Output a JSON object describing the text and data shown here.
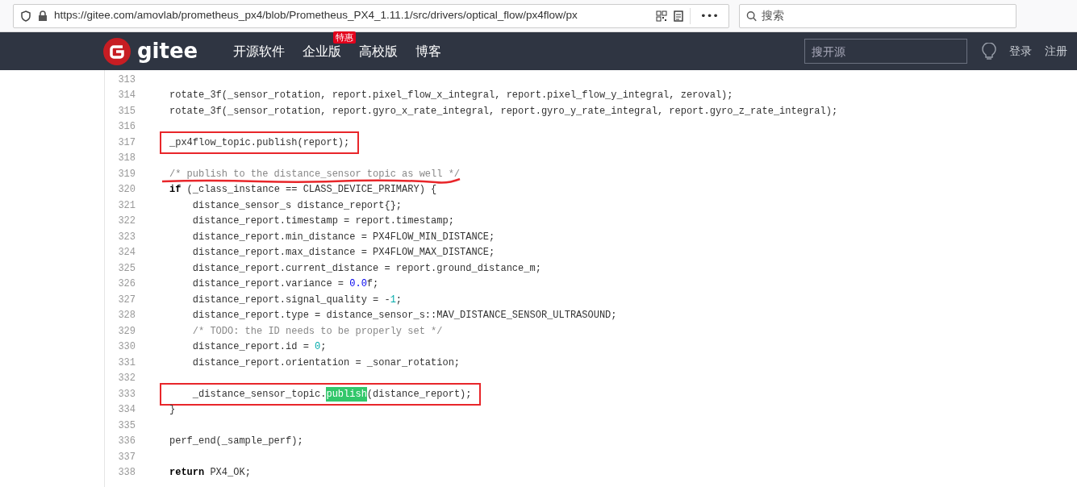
{
  "browser": {
    "url": "https://gitee.com/amovlab/prometheus_px4/blob/Prometheus_PX4_1.11.1/src/drivers/optical_flow/px4flow/px",
    "more": "•••",
    "search": {
      "placeholder": "搜索"
    }
  },
  "nav": {
    "logo": "gitee",
    "items": [
      {
        "label": "开源软件"
      },
      {
        "label": "企业版",
        "badge": "特惠"
      },
      {
        "label": "高校版"
      },
      {
        "label": "博客"
      }
    ],
    "search": {
      "placeholder": "搜开源"
    },
    "login": "登录",
    "register": "注册"
  },
  "code": [
    {
      "number": "313",
      "boxed": false,
      "underlined": false
    },
    {
      "number": "314",
      "boxed": false,
      "underlined": false,
      "tokens": [
        {
          "kind": "plain",
          "text": "rotate_3f(_sensor_rotation, report.pixel_flow_x_integral, report.pixel_flow_y_integral, zeroval);"
        }
      ]
    },
    {
      "number": "315",
      "boxed": false,
      "underlined": false,
      "tokens": [
        {
          "kind": "plain",
          "text": "rotate_3f(_sensor_rotation, report.gyro_x_rate_integral, report.gyro_y_rate_integral, report.gyro_z_rate_integral);"
        }
      ]
    },
    {
      "number": "316",
      "boxed": false,
      "underlined": false
    },
    {
      "number": "317",
      "boxed": true,
      "underlined": false,
      "tokens": [
        {
          "kind": "plain",
          "text": "_px4flow_topic.publish(report);"
        }
      ]
    },
    {
      "number": "318",
      "boxed": false,
      "underlined": false
    },
    {
      "number": "319",
      "boxed": false,
      "underlined": true,
      "tokens": [
        {
          "kind": "comment",
          "text": "/* publish to the distance_sensor topic as well */"
        }
      ]
    },
    {
      "number": "320",
      "boxed": false,
      "underlined": false,
      "tokens": [
        {
          "kind": "keyword",
          "text": "if"
        },
        {
          "kind": "plain",
          "text": " (_class_instance == CLASS_DEVICE_PRIMARY) {"
        }
      ]
    },
    {
      "number": "321",
      "boxed": false,
      "underlined": false,
      "tokens": [
        {
          "kind": "plain",
          "text": "    distance_sensor_s distance_report{};"
        }
      ]
    },
    {
      "number": "322",
      "boxed": false,
      "underlined": false,
      "tokens": [
        {
          "kind": "plain",
          "text": "    distance_report.timestamp = report.timestamp;"
        }
      ]
    },
    {
      "number": "323",
      "boxed": false,
      "underlined": false,
      "tokens": [
        {
          "kind": "plain",
          "text": "    distance_report.min_distance = PX4FLOW_MIN_DISTANCE;"
        }
      ]
    },
    {
      "number": "324",
      "boxed": false,
      "underlined": false,
      "tokens": [
        {
          "kind": "plain",
          "text": "    distance_report.max_distance = PX4FLOW_MAX_DISTANCE;"
        }
      ]
    },
    {
      "number": "325",
      "boxed": false,
      "underlined": false,
      "tokens": [
        {
          "kind": "plain",
          "text": "    distance_report.current_distance = report.ground_distance_m;"
        }
      ]
    },
    {
      "number": "326",
      "boxed": false,
      "underlined": false,
      "tokens": [
        {
          "kind": "plain",
          "text": "    distance_report.variance = "
        },
        {
          "kind": "float",
          "text": "0.0"
        },
        {
          "kind": "plain",
          "text": "f;"
        }
      ]
    },
    {
      "number": "327",
      "boxed": false,
      "underlined": false,
      "tokens": [
        {
          "kind": "plain",
          "text": "    distance_report.signal_quality = -"
        },
        {
          "kind": "int",
          "text": "1"
        },
        {
          "kind": "plain",
          "text": ";"
        }
      ]
    },
    {
      "number": "328",
      "boxed": false,
      "underlined": false,
      "tokens": [
        {
          "kind": "plain",
          "text": "    distance_report.type = distance_sensor_s::MAV_DISTANCE_SENSOR_ULTRASOUND;"
        }
      ]
    },
    {
      "number": "329",
      "boxed": false,
      "underlined": false,
      "tokens": [
        {
          "kind": "comment",
          "text": "    /* TODO: the ID needs to be properly set */"
        }
      ]
    },
    {
      "number": "330",
      "boxed": false,
      "underlined": false,
      "tokens": [
        {
          "kind": "plain",
          "text": "    distance_report.id = "
        },
        {
          "kind": "int",
          "text": "0"
        },
        {
          "kind": "plain",
          "text": ";"
        }
      ]
    },
    {
      "number": "331",
      "boxed": false,
      "underlined": false,
      "tokens": [
        {
          "kind": "plain",
          "text": "    distance_report.orientation = _sonar_rotation;"
        }
      ]
    },
    {
      "number": "332",
      "boxed": false,
      "underlined": false
    },
    {
      "number": "333",
      "boxed": true,
      "underlined": false,
      "tokens": [
        {
          "kind": "plain",
          "text": "    _distance_sensor_topic."
        },
        {
          "kind": "match",
          "text": "publish"
        },
        {
          "kind": "plain",
          "text": "(distance_report);"
        }
      ]
    },
    {
      "number": "334",
      "boxed": false,
      "underlined": false,
      "tokens": [
        {
          "kind": "plain",
          "text": "}"
        }
      ]
    },
    {
      "number": "335",
      "boxed": false,
      "underlined": false
    },
    {
      "number": "336",
      "boxed": false,
      "underlined": false,
      "tokens": [
        {
          "kind": "plain",
          "text": "perf_end(_sample_perf);"
        }
      ]
    },
    {
      "number": "337",
      "boxed": false,
      "underlined": false
    },
    {
      "number": "338",
      "boxed": false,
      "underlined": false,
      "tokens": [
        {
          "kind": "keyword",
          "text": "return"
        },
        {
          "kind": "plain",
          "text": " PX4_OK;"
        }
      ]
    }
  ]
}
